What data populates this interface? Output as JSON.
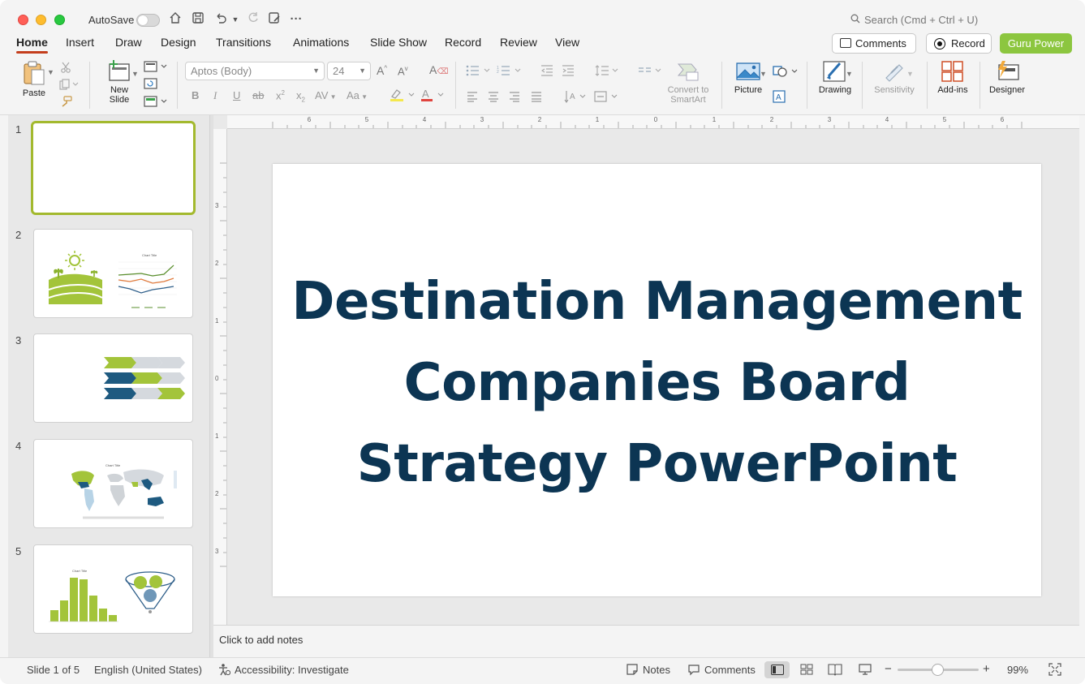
{
  "titlebar": {
    "autosave_label": "AutoSave",
    "search_placeholder": "Search (Cmd + Ctrl + U)"
  },
  "tabs": [
    "Home",
    "Insert",
    "Draw",
    "Design",
    "Transitions",
    "Animations",
    "Slide Show",
    "Record",
    "Review",
    "View"
  ],
  "actions": {
    "comments": "Comments",
    "record": "Record",
    "guru": "Guru Power"
  },
  "ribbon": {
    "paste": "Paste",
    "new_slide_line1": "New",
    "new_slide_line2": "Slide",
    "font_name": "Aptos (Body)",
    "font_size": "24",
    "convert_line1": "Convert to",
    "convert_line2": "SmartArt",
    "picture": "Picture",
    "drawing": "Drawing",
    "sensitivity": "Sensitivity",
    "addins": "Add-ins",
    "designer": "Designer"
  },
  "slides": {
    "numbers": [
      "1",
      "2",
      "3",
      "4",
      "5"
    ]
  },
  "main_slide": {
    "title_line1": "Destination Management",
    "title_line2": "Companies Board",
    "title_line3": "Strategy PowerPoint"
  },
  "notes": {
    "placeholder": "Click to add notes"
  },
  "status": {
    "slide_count": "Slide 1 of 5",
    "language": "English (United States)",
    "accessibility": "Accessibility: Investigate",
    "notes": "Notes",
    "comments": "Comments",
    "zoom": "99%"
  },
  "colors": {
    "title": "#0c3553",
    "accent_green": "#a3c43a",
    "accent_blue": "#1e5a80",
    "brand_red": "#c43e1c"
  }
}
